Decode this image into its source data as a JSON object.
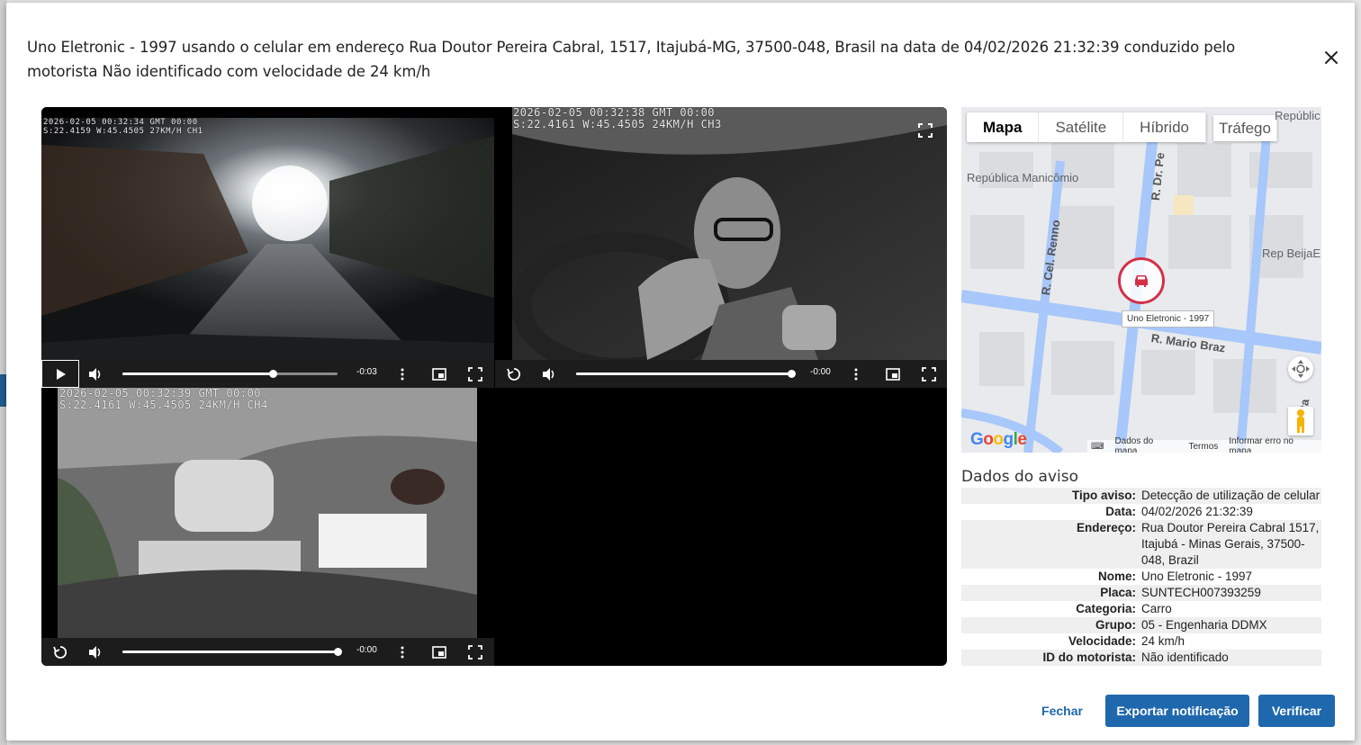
{
  "dialog": {
    "title": "Uno Eletronic - 1997 usando o celular em endereço Rua Doutor Pereira Cabral, 1517, Itajubá-MG, 37500-048, Brasil na data de 04/02/2026 21:32:39 conduzido pelo motorista Não identificado com velocidade de 24 km/h"
  },
  "videos": [
    {
      "osd_line1": "2026-02-05 00:32:34 GMT 00:00",
      "osd_line2": "S:22.4159 W:45.4505 27KM/H CH1",
      "time": "-0:03",
      "progress": 0.7,
      "state": "paused"
    },
    {
      "osd_line1": "2026-02-05 00:32:38 GMT 00:00",
      "osd_line2": "S:22.4161 W:45.4505 24KM/H CH3",
      "time": "-0:00",
      "progress": 1.0,
      "state": "ended"
    },
    {
      "osd_line1": "2026-02-05 00:32:39 GMT 00:00",
      "osd_line2": "S:22.4161 W:45.4505 24KM/H CH4",
      "time": "-0:00",
      "progress": 1.0,
      "state": "ended"
    }
  ],
  "map": {
    "tabs": [
      "Mapa",
      "Satélite",
      "Híbrido"
    ],
    "traffic_label": "Tráfego",
    "places": {
      "republica": "República Manicômio",
      "republica_top": "Repúblic",
      "rep_beija": "Rep BeijaE"
    },
    "streets": {
      "cel_renno": "R. Cel. Renno",
      "dr_pe": "R. Dr. Pe",
      "mario_braz": "R. Mario Braz",
      "right": "Ra"
    },
    "vehicle_tag": "Uno Eletronic - 1997",
    "logo": "Google",
    "footer": [
      "Dados do mapa",
      "Termos",
      "Informar erro no mapa"
    ]
  },
  "details": {
    "title": "Dados do aviso",
    "rows": [
      {
        "k": "Tipo aviso:",
        "v": "Detecção de utilização de celular"
      },
      {
        "k": "Data:",
        "v": "04/02/2026 21:32:39"
      },
      {
        "k": "Endereço:",
        "v": "Rua Doutor Pereira Cabral 1517, Itajubá - Minas Gerais, 37500-048, Brazil"
      },
      {
        "k": "Nome:",
        "v": "Uno Eletronic - 1997"
      },
      {
        "k": "Placa:",
        "v": "SUNTECH007393259"
      },
      {
        "k": "Categoria:",
        "v": "Carro"
      },
      {
        "k": "Grupo:",
        "v": "05 - Engenharia DDMX"
      },
      {
        "k": "Velocidade:",
        "v": "24 km/h"
      },
      {
        "k": "ID do motorista:",
        "v": "Não identificado"
      }
    ]
  },
  "footer": {
    "close_label": "Fechar",
    "export_label": "Exportar notificação",
    "verify_label": "Verificar"
  },
  "colors": {
    "primary": "#1f68ad",
    "pin": "#d3304a"
  }
}
